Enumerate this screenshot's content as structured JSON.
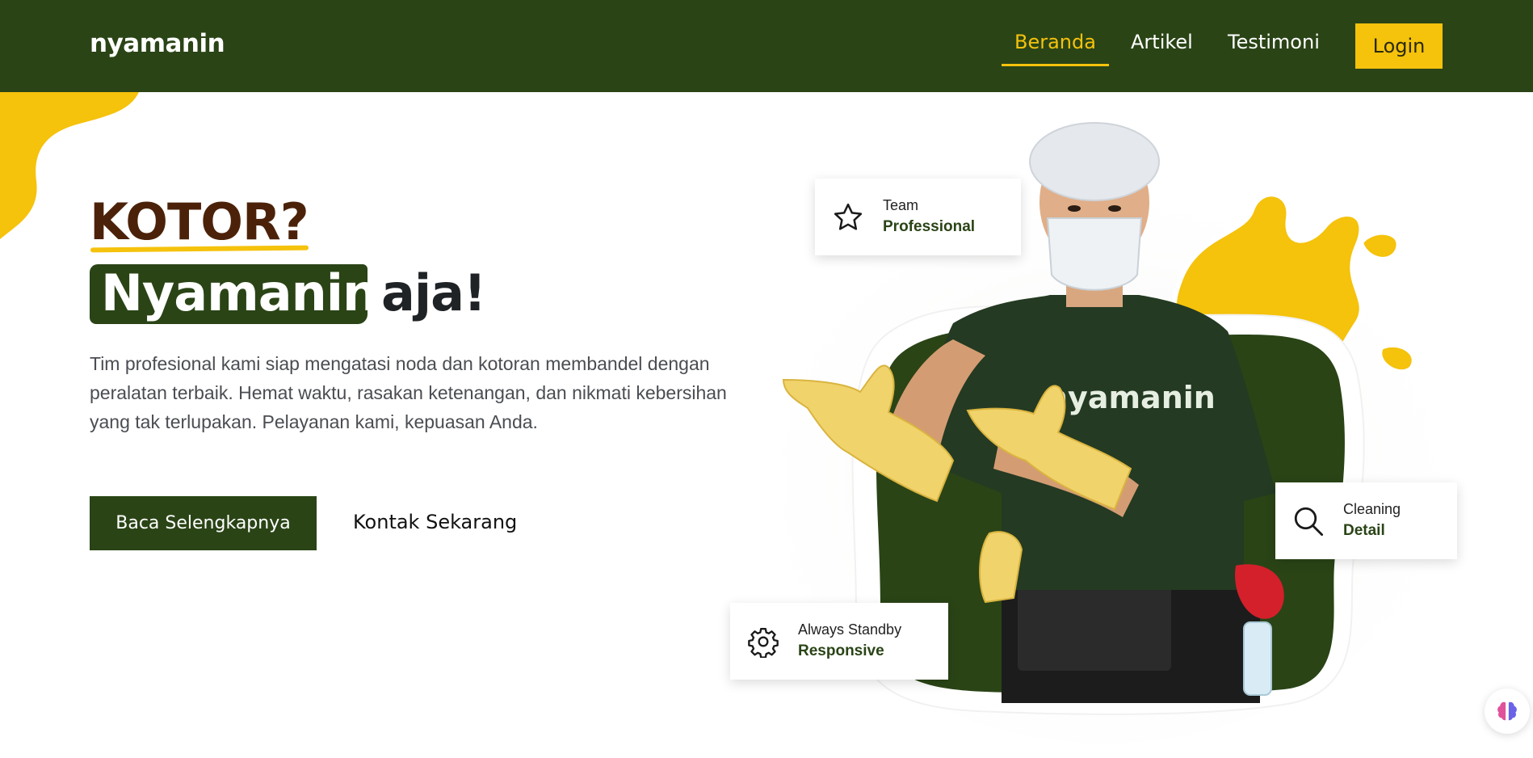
{
  "nav": {
    "brand": "nyamanin",
    "links": [
      {
        "label": "Beranda",
        "active": true
      },
      {
        "label": "Artikel",
        "active": false
      },
      {
        "label": "Testimoni",
        "active": false
      }
    ],
    "login_label": "Login"
  },
  "hero": {
    "line1": "KOTOR?",
    "highlight_word": "Nyamanin",
    "line2_rest": "aja!",
    "description": "Tim profesional kami siap mengatasi noda dan kotoran membandel dengan peralatan terbaik. Hemat waktu, rasakan ketenangan, dan nikmati kebersihan yang tak terlupakan. Pelayanan kami, kepuasan Anda.",
    "primary_button": "Baca Selengkapnya",
    "secondary_button": "Kontak Sekarang",
    "shirt_text": "nyamanin"
  },
  "cards": [
    {
      "icon": "star-icon",
      "small": "Team",
      "big": "Professional"
    },
    {
      "icon": "search-icon",
      "small": "Cleaning",
      "big": "Detail"
    },
    {
      "icon": "gear-icon",
      "small": "Always Standby",
      "big": "Responsive"
    }
  ],
  "colors": {
    "primary_green": "#2a4416",
    "accent_yellow": "#f5c20c",
    "heading_brown": "#4b2209"
  }
}
